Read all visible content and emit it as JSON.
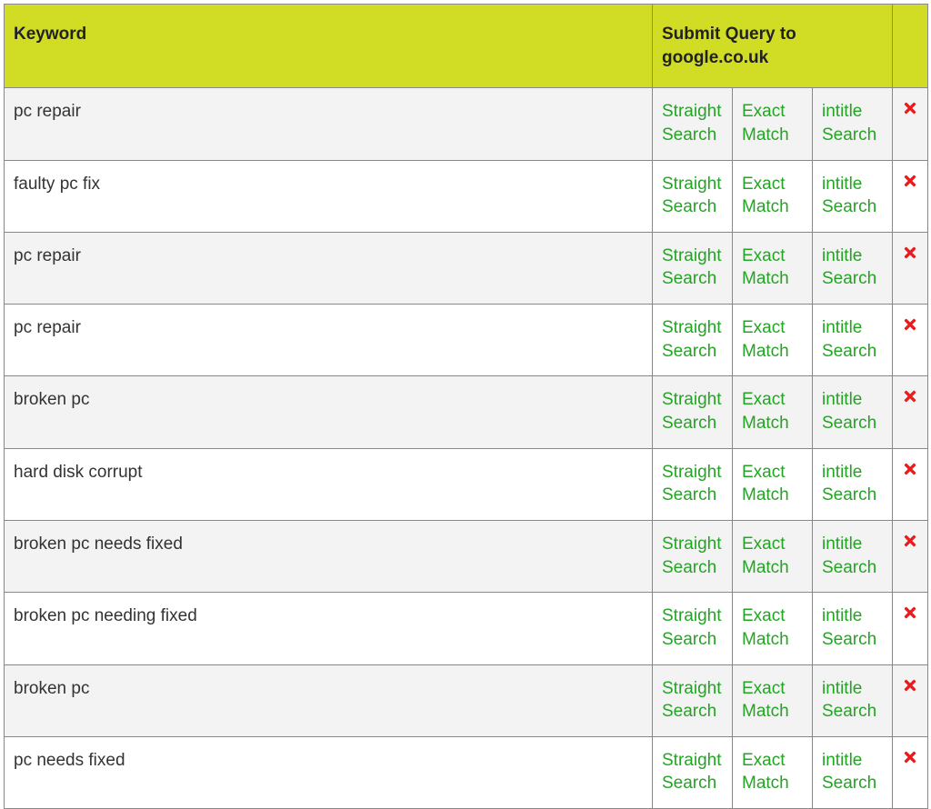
{
  "colors": {
    "header_bg": "#d1dd25",
    "link_green": "#24a424",
    "delete_red": "#e81c1c",
    "row_alt_bg": "#f3f3f3",
    "border": "#888888"
  },
  "header": {
    "keyword_label": "Keyword",
    "submit_label_prefix": "Submit Query to",
    "submit_target": "google.co.uk"
  },
  "actions": {
    "straight_search": "Straight Search",
    "exact_match": "Exact Match",
    "intitle_search": "intitle Search"
  },
  "rows": [
    {
      "keyword": "pc repair"
    },
    {
      "keyword": "faulty pc fix"
    },
    {
      "keyword": "pc repair"
    },
    {
      "keyword": "pc repair"
    },
    {
      "keyword": "broken pc"
    },
    {
      "keyword": "hard disk corrupt"
    },
    {
      "keyword": "broken pc needs fixed"
    },
    {
      "keyword": "broken pc needing fixed"
    },
    {
      "keyword": "broken pc"
    },
    {
      "keyword": "pc needs fixed"
    }
  ]
}
